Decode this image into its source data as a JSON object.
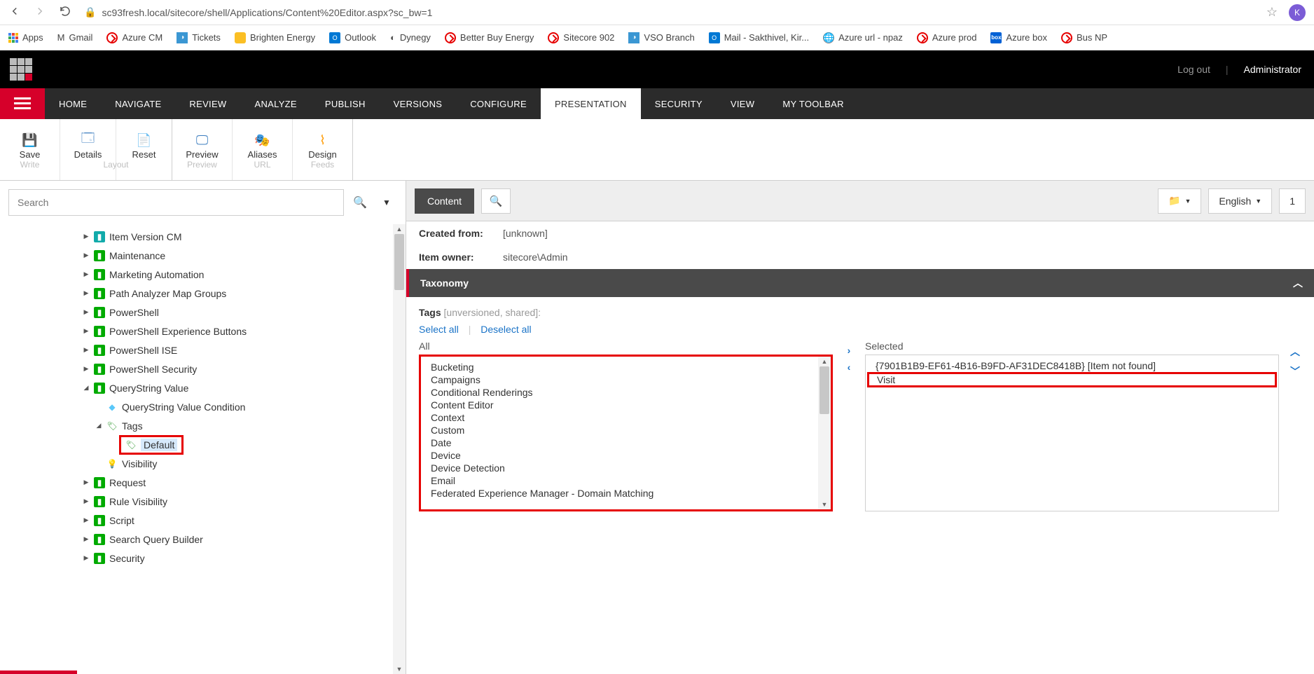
{
  "browser": {
    "url": "sc93fresh.local/sitecore/shell/Applications/Content%20Editor.aspx?sc_bw=1",
    "avatar_initial": "K"
  },
  "bookmarks": [
    {
      "label": "Apps",
      "icon": "apps"
    },
    {
      "label": "Gmail",
      "icon": "gmail"
    },
    {
      "label": "Azure CM",
      "icon": "red"
    },
    {
      "label": "Tickets",
      "icon": "ticket"
    },
    {
      "label": "Brighten Energy",
      "icon": "yellow"
    },
    {
      "label": "Outlook",
      "icon": "outlook"
    },
    {
      "label": "Dynegy",
      "icon": "dynegy"
    },
    {
      "label": "Better Buy Energy",
      "icon": "red"
    },
    {
      "label": "Sitecore 902",
      "icon": "red"
    },
    {
      "label": "VSO Branch",
      "icon": "ticket"
    },
    {
      "label": "Mail - Sakthivel, Kir...",
      "icon": "outlook"
    },
    {
      "label": "Azure url - npaz",
      "icon": "globe"
    },
    {
      "label": "Azure prod",
      "icon": "red"
    },
    {
      "label": "Azure box",
      "icon": "box"
    },
    {
      "label": "Bus NP",
      "icon": "red"
    }
  ],
  "header": {
    "logout": "Log out",
    "user": "Administrator"
  },
  "tabs": [
    "HOME",
    "NAVIGATE",
    "REVIEW",
    "ANALYZE",
    "PUBLISH",
    "VERSIONS",
    "CONFIGURE",
    "PRESENTATION",
    "SECURITY",
    "VIEW",
    "MY TOOLBAR"
  ],
  "active_tab": "PRESENTATION",
  "ribbon": [
    {
      "label": "Save",
      "sub": "Write",
      "icon": "💾"
    },
    {
      "label": "Details",
      "sub": "",
      "icon": "⧉"
    },
    {
      "label": "Reset",
      "sub": "",
      "icon": "🗋"
    },
    {
      "layout_sub": "Layout"
    },
    {
      "label": "Preview",
      "sub": "Preview",
      "icon": "👁"
    },
    {
      "label": "Aliases",
      "sub": "URL",
      "icon": "🎭"
    },
    {
      "label": "Design",
      "sub": "Feeds",
      "icon": "📶"
    }
  ],
  "search": {
    "placeholder": "Search"
  },
  "tree": [
    {
      "label": "Item Version CM",
      "icon": "teal",
      "exp": "▶",
      "indent": 0
    },
    {
      "label": "Maintenance",
      "icon": "green",
      "exp": "▶",
      "indent": 0
    },
    {
      "label": "Marketing Automation",
      "icon": "green",
      "exp": "▶",
      "indent": 0
    },
    {
      "label": "Path Analyzer Map Groups",
      "icon": "green",
      "exp": "▶",
      "indent": 0
    },
    {
      "label": "PowerShell",
      "icon": "green",
      "exp": "▶",
      "indent": 0
    },
    {
      "label": "PowerShell Experience Buttons",
      "icon": "green",
      "exp": "▶",
      "indent": 0
    },
    {
      "label": "PowerShell ISE",
      "icon": "green",
      "exp": "▶",
      "indent": 0
    },
    {
      "label": "PowerShell Security",
      "icon": "green",
      "exp": "▶",
      "indent": 0
    },
    {
      "label": "QueryString Value",
      "icon": "green",
      "exp": "◢",
      "indent": 0
    },
    {
      "label": "QueryString Value Condition",
      "icon": "dia",
      "exp": "",
      "indent": 1
    },
    {
      "label": "Tags",
      "icon": "tag",
      "exp": "◢",
      "indent": 1
    },
    {
      "label": "Default",
      "icon": "tag",
      "exp": "",
      "indent": 2,
      "hl": true,
      "sel": true
    },
    {
      "label": "Visibility",
      "icon": "bulb",
      "exp": "",
      "indent": 1
    },
    {
      "label": "Request",
      "icon": "green",
      "exp": "▶",
      "indent": 0
    },
    {
      "label": "Rule Visibility",
      "icon": "green",
      "exp": "▶",
      "indent": 0
    },
    {
      "label": "Script",
      "icon": "green",
      "exp": "▶",
      "indent": 0
    },
    {
      "label": "Search Query Builder",
      "icon": "green",
      "exp": "▶",
      "indent": 0
    },
    {
      "label": "Security",
      "icon": "green",
      "exp": "▶",
      "indent": 0
    }
  ],
  "right": {
    "content_label": "Content",
    "folder_dd": "▾",
    "lang": "English",
    "ver": "1",
    "meta": [
      {
        "k": "Created from:",
        "v": "[unknown]"
      },
      {
        "k": "Item owner:",
        "v": "sitecore\\Admin"
      }
    ],
    "section": "Taxonomy",
    "tags_label": "Tags",
    "tags_suffix": "[unversioned, shared]:",
    "select_all": "Select all",
    "deselect_all": "Deselect all",
    "all_label": "All",
    "selected_label": "Selected",
    "all_items": [
      "Bucketing",
      "Campaigns",
      "Conditional Renderings",
      "Content Editor",
      "Context",
      "Custom",
      "Date",
      "Device",
      "Device Detection",
      "Email",
      "Federated Experience Manager - Domain Matching"
    ],
    "selected_items": [
      {
        "text": "{7901B1B9-EF61-4B16-B9FD-AF31DEC8418B} [Item not found]",
        "box": false
      },
      {
        "text": "Visit",
        "box": true
      }
    ]
  }
}
